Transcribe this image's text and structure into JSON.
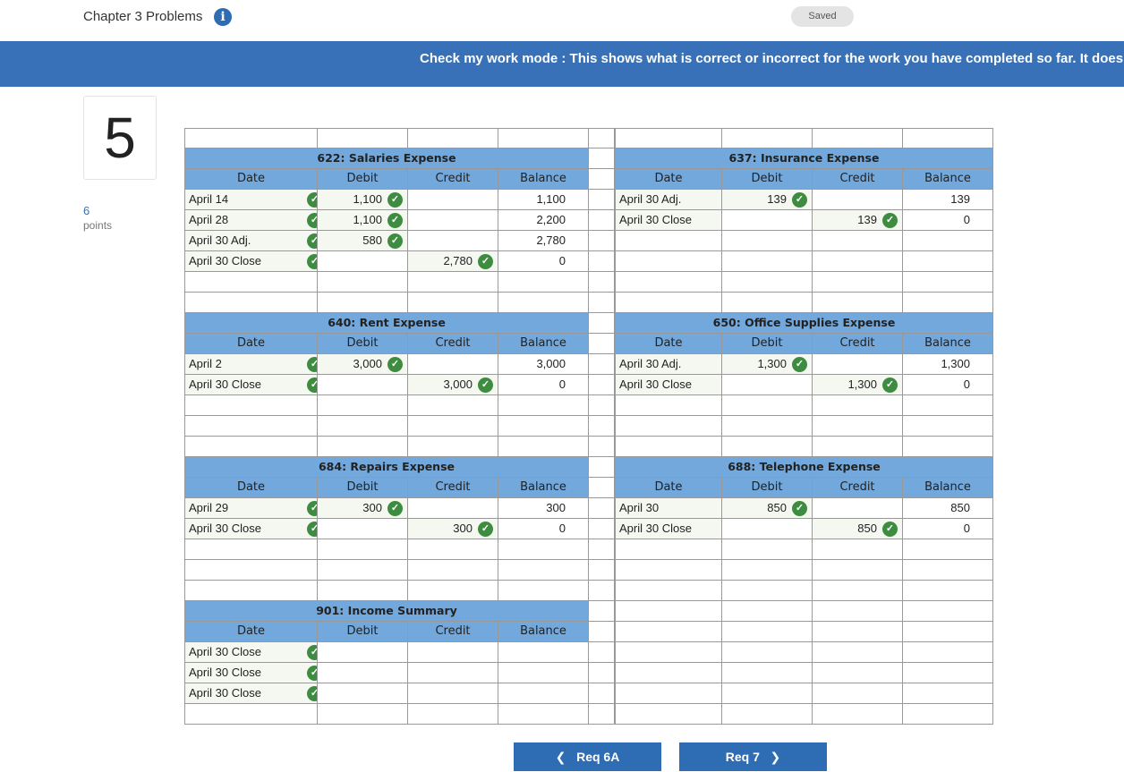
{
  "header": {
    "title": "Chapter 3 Problems",
    "info_icon": "i",
    "saved": "Saved"
  },
  "banner": {
    "text": "Check my work mode : This shows what is correct or incorrect for the work you have completed so far. It does"
  },
  "question": {
    "number": "5",
    "points_value": "6",
    "points_label": "points"
  },
  "columns": [
    "Date",
    "Debit",
    "Credit",
    "Balance"
  ],
  "ledgers": [
    {
      "title": "622: Salaries Expense",
      "rows": [
        {
          "date": "April 14",
          "debit": "1,100",
          "credit": "",
          "balance": "1,100"
        },
        {
          "date": "April 28",
          "debit": "1,100",
          "credit": "",
          "balance": "2,200"
        },
        {
          "date": "April 30 Adj.",
          "debit": "580",
          "credit": "",
          "balance": "2,780"
        },
        {
          "date": "April 30 Close",
          "debit": "",
          "credit": "2,780",
          "balance": "0"
        }
      ]
    },
    {
      "title": "637: Insurance Expense",
      "rows": [
        {
          "date": "April 30 Adj.",
          "debit": "139",
          "credit": "",
          "balance": "139"
        },
        {
          "date": "April 30 Close",
          "debit": "",
          "credit": "139",
          "balance": "0"
        }
      ]
    },
    {
      "title": "640: Rent Expense",
      "rows": [
        {
          "date": "April 2",
          "debit": "3,000",
          "credit": "",
          "balance": "3,000"
        },
        {
          "date": "April 30 Close",
          "debit": "",
          "credit": "3,000",
          "balance": "0"
        }
      ]
    },
    {
      "title": "650: Office Supplies Expense",
      "rows": [
        {
          "date": "April 30 Adj.",
          "debit": "1,300",
          "credit": "",
          "balance": "1,300"
        },
        {
          "date": "April 30 Close",
          "debit": "",
          "credit": "1,300",
          "balance": "0"
        }
      ]
    },
    {
      "title": "684: Repairs Expense",
      "rows": [
        {
          "date": "April 29",
          "debit": "300",
          "credit": "",
          "balance": "300"
        },
        {
          "date": "April 30 Close",
          "debit": "",
          "credit": "300",
          "balance": "0"
        }
      ]
    },
    {
      "title": "688: Telephone Expense",
      "rows": [
        {
          "date": "April 30",
          "debit": "850",
          "credit": "",
          "balance": "850"
        },
        {
          "date": "April 30 Close",
          "debit": "",
          "credit": "850",
          "balance": "0"
        }
      ]
    },
    {
      "title": "901: Income Summary",
      "rows": [
        {
          "date": "April 30 Close",
          "debit": "",
          "credit": "",
          "balance": ""
        },
        {
          "date": "April 30 Close",
          "debit": "",
          "credit": "",
          "balance": ""
        },
        {
          "date": "April 30 Close",
          "debit": "",
          "credit": "",
          "balance": ""
        }
      ]
    }
  ],
  "nav": {
    "prev_label": "Req 6A",
    "next_label": "Req 7",
    "prev_icon": "chevron-left-icon",
    "next_icon": "chevron-right-icon"
  },
  "colors": {
    "banner": "#3871b7",
    "header_fill": "#72a8dc",
    "check": "#3d8c40",
    "button": "#2e6db4"
  }
}
